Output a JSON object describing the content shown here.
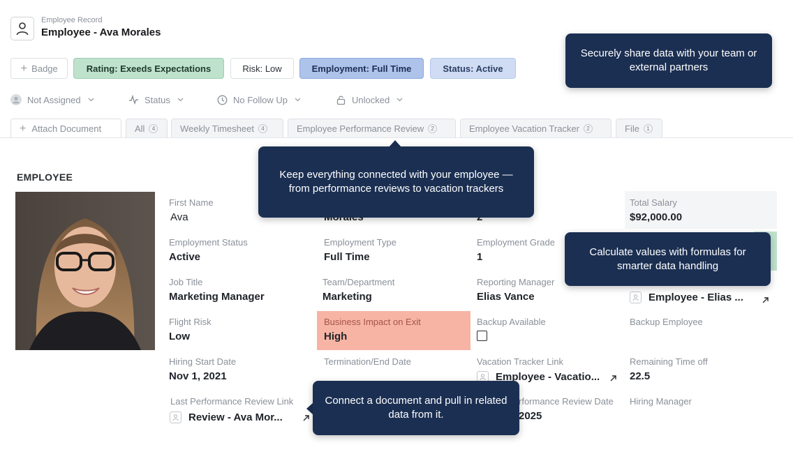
{
  "header": {
    "subtitle": "Employee Record",
    "title": "Employee - Ava Morales",
    "icon": "user-icon"
  },
  "badges": {
    "add_label": "Badge",
    "rating": "Rating: Exeeds Expectations",
    "risk": "Risk: Low",
    "employment": "Employment: Full Time",
    "status": "Status: Active"
  },
  "meta": {
    "assignee": "Not Assigned",
    "status": "Status",
    "follow_up": "No Follow Up",
    "lock": "Unlocked"
  },
  "tabs": [
    {
      "label": "Attach Document"
    },
    {
      "label": "All",
      "count": "4"
    },
    {
      "label": "Weekly Timesheet",
      "count": "4"
    },
    {
      "label": "Employee Performance Review",
      "count": "2"
    },
    {
      "label": "Employee Vacation Tracker",
      "count": "2"
    },
    {
      "label": "File",
      "count": "1"
    }
  ],
  "section_title": "EMPLOYEE",
  "fields": {
    "first_name": {
      "label": "First Name",
      "value": "Ava"
    },
    "last_name": {
      "value": "Morales"
    },
    "col3_row1": {
      "value": "2"
    },
    "total_salary": {
      "label": "Total Salary",
      "value": "$92,000.00"
    },
    "employment_status": {
      "label": "Employment Status",
      "value": "Active"
    },
    "employment_type": {
      "label": "Employment Type",
      "value": "Full Time"
    },
    "employment_grade": {
      "label": "Employment Grade",
      "value": "1"
    },
    "job_title": {
      "label": "Job Title",
      "value": "Marketing Manager"
    },
    "team": {
      "label": "Team/Department",
      "value": "Marketing"
    },
    "reporting_manager": {
      "label": "Reporting Manager",
      "value": "Elias Vance"
    },
    "col4_row3": {
      "value": "Employee - Elias ..."
    },
    "flight_risk": {
      "label": "Flight Risk",
      "value": "Low"
    },
    "business_impact": {
      "label": "Business Impact on Exit",
      "value": "High"
    },
    "backup_available": {
      "label": "Backup Available"
    },
    "backup_employee": {
      "label": "Backup Employee"
    },
    "hiring_start": {
      "label": "Hiring Start Date",
      "value": "Nov 1, 2021"
    },
    "termination": {
      "label": "Termination/End Date"
    },
    "vacation_link": {
      "label": "Vacation Tracker Link",
      "value": "Employee - Vacatio..."
    },
    "remaining_time": {
      "label": "Remaining Time off",
      "value": "22.5"
    },
    "last_review_link": {
      "label": "Last Performance Review Link",
      "value": "Review - Ava Mor..."
    },
    "review_date": {
      "label": "rformance Review Date",
      "value": "2025"
    },
    "hiring_manager": {
      "label": "Hiring Manager"
    }
  },
  "tooltips": {
    "share": "Securely share data with your team or external partners",
    "connected": "Keep everything connected with your employee — from performance reviews to vacation trackers",
    "formulas": "Calculate values with formulas for smarter data handling",
    "document": "Connect a document and pull in related data from it."
  },
  "colors": {
    "rating_badge": "#bfe2cd",
    "employment_badge": "#aec3ea",
    "status_badge": "#cfdcf3",
    "impact_highlight": "#f7b4a4",
    "tooltip_bg": "#1b2f52"
  }
}
